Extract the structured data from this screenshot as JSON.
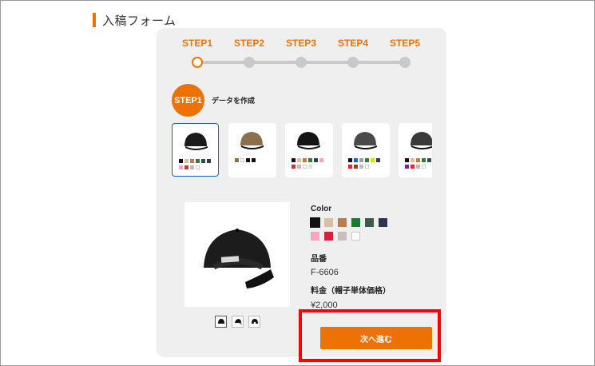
{
  "page": {
    "title": "入稿フォーム"
  },
  "steps": [
    {
      "label": "STEP1",
      "active": true
    },
    {
      "label": "STEP2",
      "active": false
    },
    {
      "label": "STEP3",
      "active": false
    },
    {
      "label": "STEP4",
      "active": false
    },
    {
      "label": "STEP5",
      "active": false
    }
  ],
  "current_step": {
    "badge": "STEP1",
    "description": "データを作成"
  },
  "thumbnails": [
    {
      "name": "cap-black",
      "cap_color": "#1a1a1a",
      "selected": true,
      "swatches": [
        "#111111",
        "#d8c1a3",
        "#c07a4a",
        "#2e7d32",
        "#2f4f4f",
        "#2c3e50",
        "#f3a6c4",
        "#d32f2f",
        "#c9b5b5",
        "#ffffff"
      ]
    },
    {
      "name": "cap-camo",
      "cap_color": "#8b6f4e",
      "selected": false,
      "swatches": [
        "#8b6f4e",
        "#ffffff",
        "#111111",
        "#111111"
      ]
    },
    {
      "name": "cap-black-white",
      "cap_color": "#151515",
      "selected": false,
      "swatches": [
        "#111111",
        "#d8c1a3",
        "#c07a4a",
        "#2e7d32",
        "#2c3e50",
        "#f3a6c4",
        "#d32f2f",
        "#c9b5b5",
        "#ffffff",
        "#e0e0e0"
      ]
    },
    {
      "name": "cap-charcoal",
      "cap_color": "#4a4a4a",
      "selected": false,
      "swatches": [
        "#111111",
        "#1565c0",
        "#9e9e9e",
        "#2e7d32",
        "#cddc39",
        "#2c3e50",
        "#d32f2f",
        "#8b4513",
        "#c9b5b5",
        "#ffffff"
      ]
    },
    {
      "name": "cap-dark-gray",
      "cap_color": "#3a3a3a",
      "selected": false,
      "swatches": [
        "#111111",
        "#d8c1a3",
        "#c07a4a",
        "#2e7d32",
        "#2f4f4f",
        "#8b0000",
        "#7b1fa2",
        "#d32f2f",
        "#c9b5b5",
        "#ffffff"
      ]
    }
  ],
  "product": {
    "color_label": "Color",
    "colors": [
      {
        "name": "black",
        "hex": "#111111",
        "selected": true
      },
      {
        "name": "khaki",
        "hex": "#d8c1a3"
      },
      {
        "name": "brown",
        "hex": "#c07a4a"
      },
      {
        "name": "green",
        "hex": "#1b7a2b"
      },
      {
        "name": "dark-green",
        "hex": "#3d5a4a"
      },
      {
        "name": "navy",
        "hex": "#2c3550"
      },
      {
        "name": "pink",
        "hex": "#f3a6c4"
      },
      {
        "name": "red",
        "hex": "#d3223a"
      },
      {
        "name": "silver",
        "hex": "#cbbdbd"
      },
      {
        "name": "white",
        "hex": "#ffffff"
      }
    ],
    "code_label": "品番",
    "code_value": "F-6606",
    "price_label": "料金（帽子単体価格）",
    "price_value": "¥2,000"
  },
  "actions": {
    "next_label": "次へ進む"
  },
  "colors": {
    "accent": "#ee7203",
    "highlight": "#ff0000",
    "selected_border": "#1f5fbf"
  }
}
